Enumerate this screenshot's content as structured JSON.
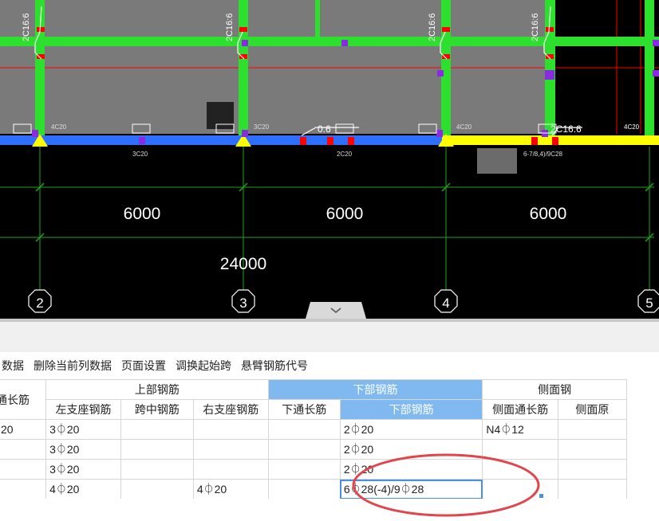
{
  "cad": {
    "span_labels": [
      "6000",
      "6000",
      "6000"
    ],
    "total_label": "24000",
    "axis_labels": [
      "2",
      "3",
      "4",
      "5"
    ],
    "rebar_annotations": [
      "2C16:6",
      "2C16:6",
      "2C16:6",
      "2C16:6"
    ],
    "small_labels": [
      "4C20",
      "3C20",
      "4C20",
      "4C20",
      "3C20",
      "2C20",
      "6-7/8,4)/9C28"
    ],
    "beam_note_1": "0:6",
    "beam_note_2": "2C16:6",
    "colors": {
      "background": "#000000",
      "slab": "#7a7a7a",
      "column_green": "#2ee02e",
      "beam_blue": "#2f6fff",
      "beam_yellow": "#ffff00",
      "accent_red": "#ff0000",
      "marker_purple": "#8a2be2",
      "dim_green": "#1fa31f"
    }
  },
  "toolbar": {
    "items": [
      "数据",
      "删除当前列数据",
      "页面设置",
      "调换起始跨",
      "悬臂钢筋代号"
    ]
  },
  "table": {
    "group_headers": {
      "top_through": "上通长筋",
      "top_rebar": "上部钢筋",
      "bottom_rebar": "下部钢筋",
      "side_rebar": "侧面钢"
    },
    "sub_headers": {
      "left_support": "左支座钢筋",
      "mid_span": "跨中钢筋",
      "right_support": "右支座钢筋",
      "bottom_through": "下通长筋",
      "bottom_rebar": "下部钢筋",
      "side_through": "侧面通长筋",
      "side_other": "侧面原"
    },
    "rows": [
      {
        "top_through": "20",
        "left_support": "3⏀20",
        "mid_span": "",
        "right_support": "",
        "bottom_through": "",
        "bottom_rebar": "2⏀20",
        "side_through": "N4⏀12",
        "side_other": ""
      },
      {
        "top_through": "",
        "left_support": "3⏀20",
        "mid_span": "",
        "right_support": "",
        "bottom_through": "",
        "bottom_rebar": "2⏀20",
        "side_through": "",
        "side_other": ""
      },
      {
        "top_through": "",
        "left_support": "3⏀20",
        "mid_span": "",
        "right_support": "",
        "bottom_through": "",
        "bottom_rebar": "2⏀20",
        "side_through": "",
        "side_other": ""
      },
      {
        "top_through": "",
        "left_support": "4⏀20",
        "mid_span": "",
        "right_support": "4⏀20",
        "bottom_through": "",
        "bottom_rebar": "6⏀28(-4)/9⏀28",
        "side_through": "",
        "side_other": ""
      }
    ],
    "colors": {
      "selected_header": "#7fb9ef",
      "active_border": "#4a90e2",
      "annotation_ellipse": "#e0464b"
    }
  }
}
